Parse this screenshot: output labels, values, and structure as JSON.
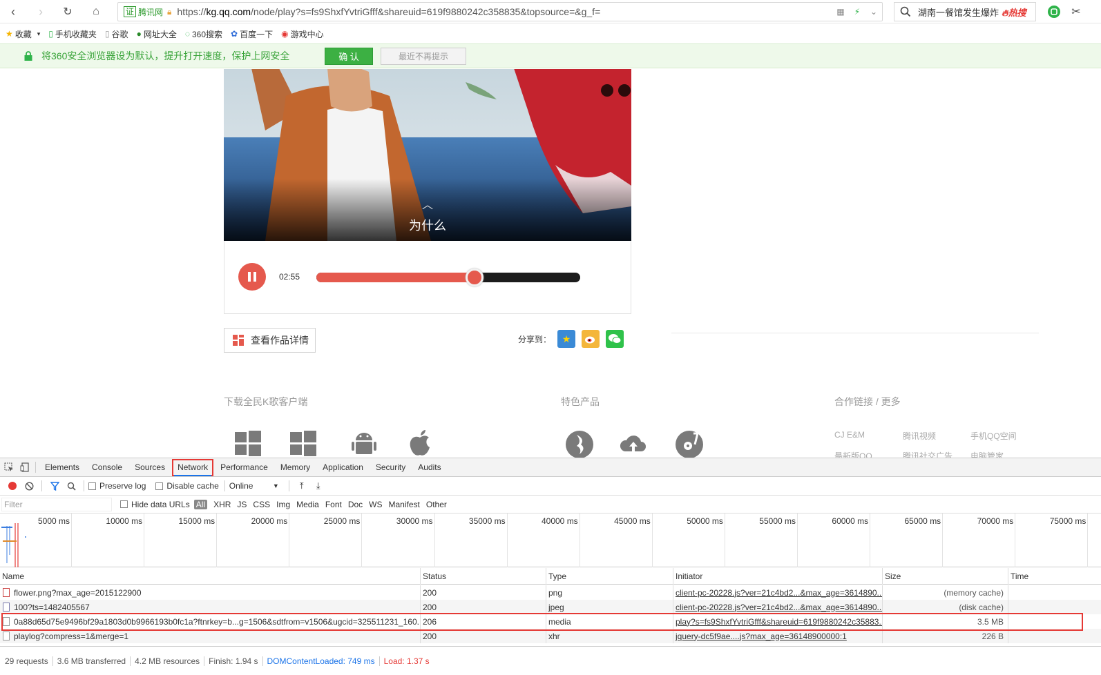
{
  "browser": {
    "address": {
      "cert_label": "证",
      "site_label": "腾讯网",
      "url_prefix": "https://",
      "url_domain": "kg.qq.com",
      "url_path": "/node/play?s=fs9ShxfYvtriGfff&shareuid=619f9880242c358835&topsource=&g_f="
    },
    "search": {
      "text": "湖南一餐馆发生爆炸",
      "badge": "热搜"
    },
    "bookmarks": [
      {
        "label": "收藏"
      },
      {
        "label": "手机收藏夹"
      },
      {
        "label": "谷歌"
      },
      {
        "label": "网址大全"
      },
      {
        "label": "360搜索"
      },
      {
        "label": "百度一下"
      },
      {
        "label": "游戏中心"
      }
    ],
    "notice": {
      "message": "将360安全浏览器设为默认，提升打开速度，保护上网安全",
      "confirm_label": "确 认",
      "dismiss_label": "最近不再提示"
    }
  },
  "player": {
    "song_title": "为什么",
    "chevron": "︿",
    "time": "02:55",
    "progress": 0.6,
    "detail_label": "查看作品详情",
    "share_label": "分享到：",
    "accent_color": "#e5594d"
  },
  "footer": {
    "download_title": "下载全民K歌客户端",
    "products_title": "特色产品",
    "partners_title": "合作链接 / 更多",
    "partner_links": [
      "CJ E&M",
      "腾讯视频",
      "手机QQ空间",
      "最新版QQ",
      "腾讯社交广告",
      "电脑管家"
    ]
  },
  "devtools": {
    "tabs": [
      "Elements",
      "Console",
      "Sources",
      "Network",
      "Performance",
      "Memory",
      "Application",
      "Security",
      "Audits"
    ],
    "active_tab": "Network",
    "toolbar": {
      "preserve_log": "Preserve log",
      "disable_cache": "Disable cache",
      "throttle": "Online"
    },
    "filter": {
      "placeholder": "Filter",
      "hide_data_urls": "Hide data URLs",
      "types": [
        "All",
        "XHR",
        "JS",
        "CSS",
        "Img",
        "Media",
        "Font",
        "Doc",
        "WS",
        "Manifest",
        "Other"
      ]
    },
    "timeline_ticks": [
      "5000 ms",
      "10000 ms",
      "15000 ms",
      "20000 ms",
      "25000 ms",
      "30000 ms",
      "35000 ms",
      "40000 ms",
      "45000 ms",
      "50000 ms",
      "55000 ms",
      "60000 ms",
      "65000 ms",
      "70000 ms",
      "75000 ms"
    ],
    "columns": [
      "Name",
      "Status",
      "Type",
      "Initiator",
      "Size",
      "Time"
    ],
    "rows": [
      {
        "name": "flower.png?max_age=2015122900",
        "status": "200",
        "type": "png",
        "initiator": "client-pc-20228.js?ver=21c4bd2...&max_age=3614890...",
        "size": "(memory cache)",
        "time": ""
      },
      {
        "name": "100?ts=1482405567",
        "status": "200",
        "type": "jpeg",
        "initiator": "client-pc-20228.js?ver=21c4bd2...&max_age=3614890...",
        "size": "(disk cache)",
        "time": ""
      },
      {
        "name": "0a88d65d75e9496bf29a1803d0b9966193b0fc1a?ftnrkey=b...g=1506&sdtfrom=v1506&ugcid=325511231_160...",
        "status": "206",
        "type": "media",
        "initiator": "play?s=fs9ShxfYvtriGfff&shareuid=619f9880242c35883...",
        "size": "3.5 MB",
        "time": ""
      },
      {
        "name": "playlog?compress=1&merge=1",
        "status": "200",
        "type": "xhr",
        "initiator": "jquery-dc5f9ae....js?max_age=36148900000:1",
        "size": "226 B",
        "time": ""
      }
    ],
    "status": {
      "requests": "29 requests",
      "transferred": "3.6 MB transferred",
      "resources": "4.2 MB resources",
      "finish": "Finish: 1.94 s",
      "dcl": "DOMContentLoaded: 749 ms",
      "load": "Load: 1.37 s"
    }
  }
}
